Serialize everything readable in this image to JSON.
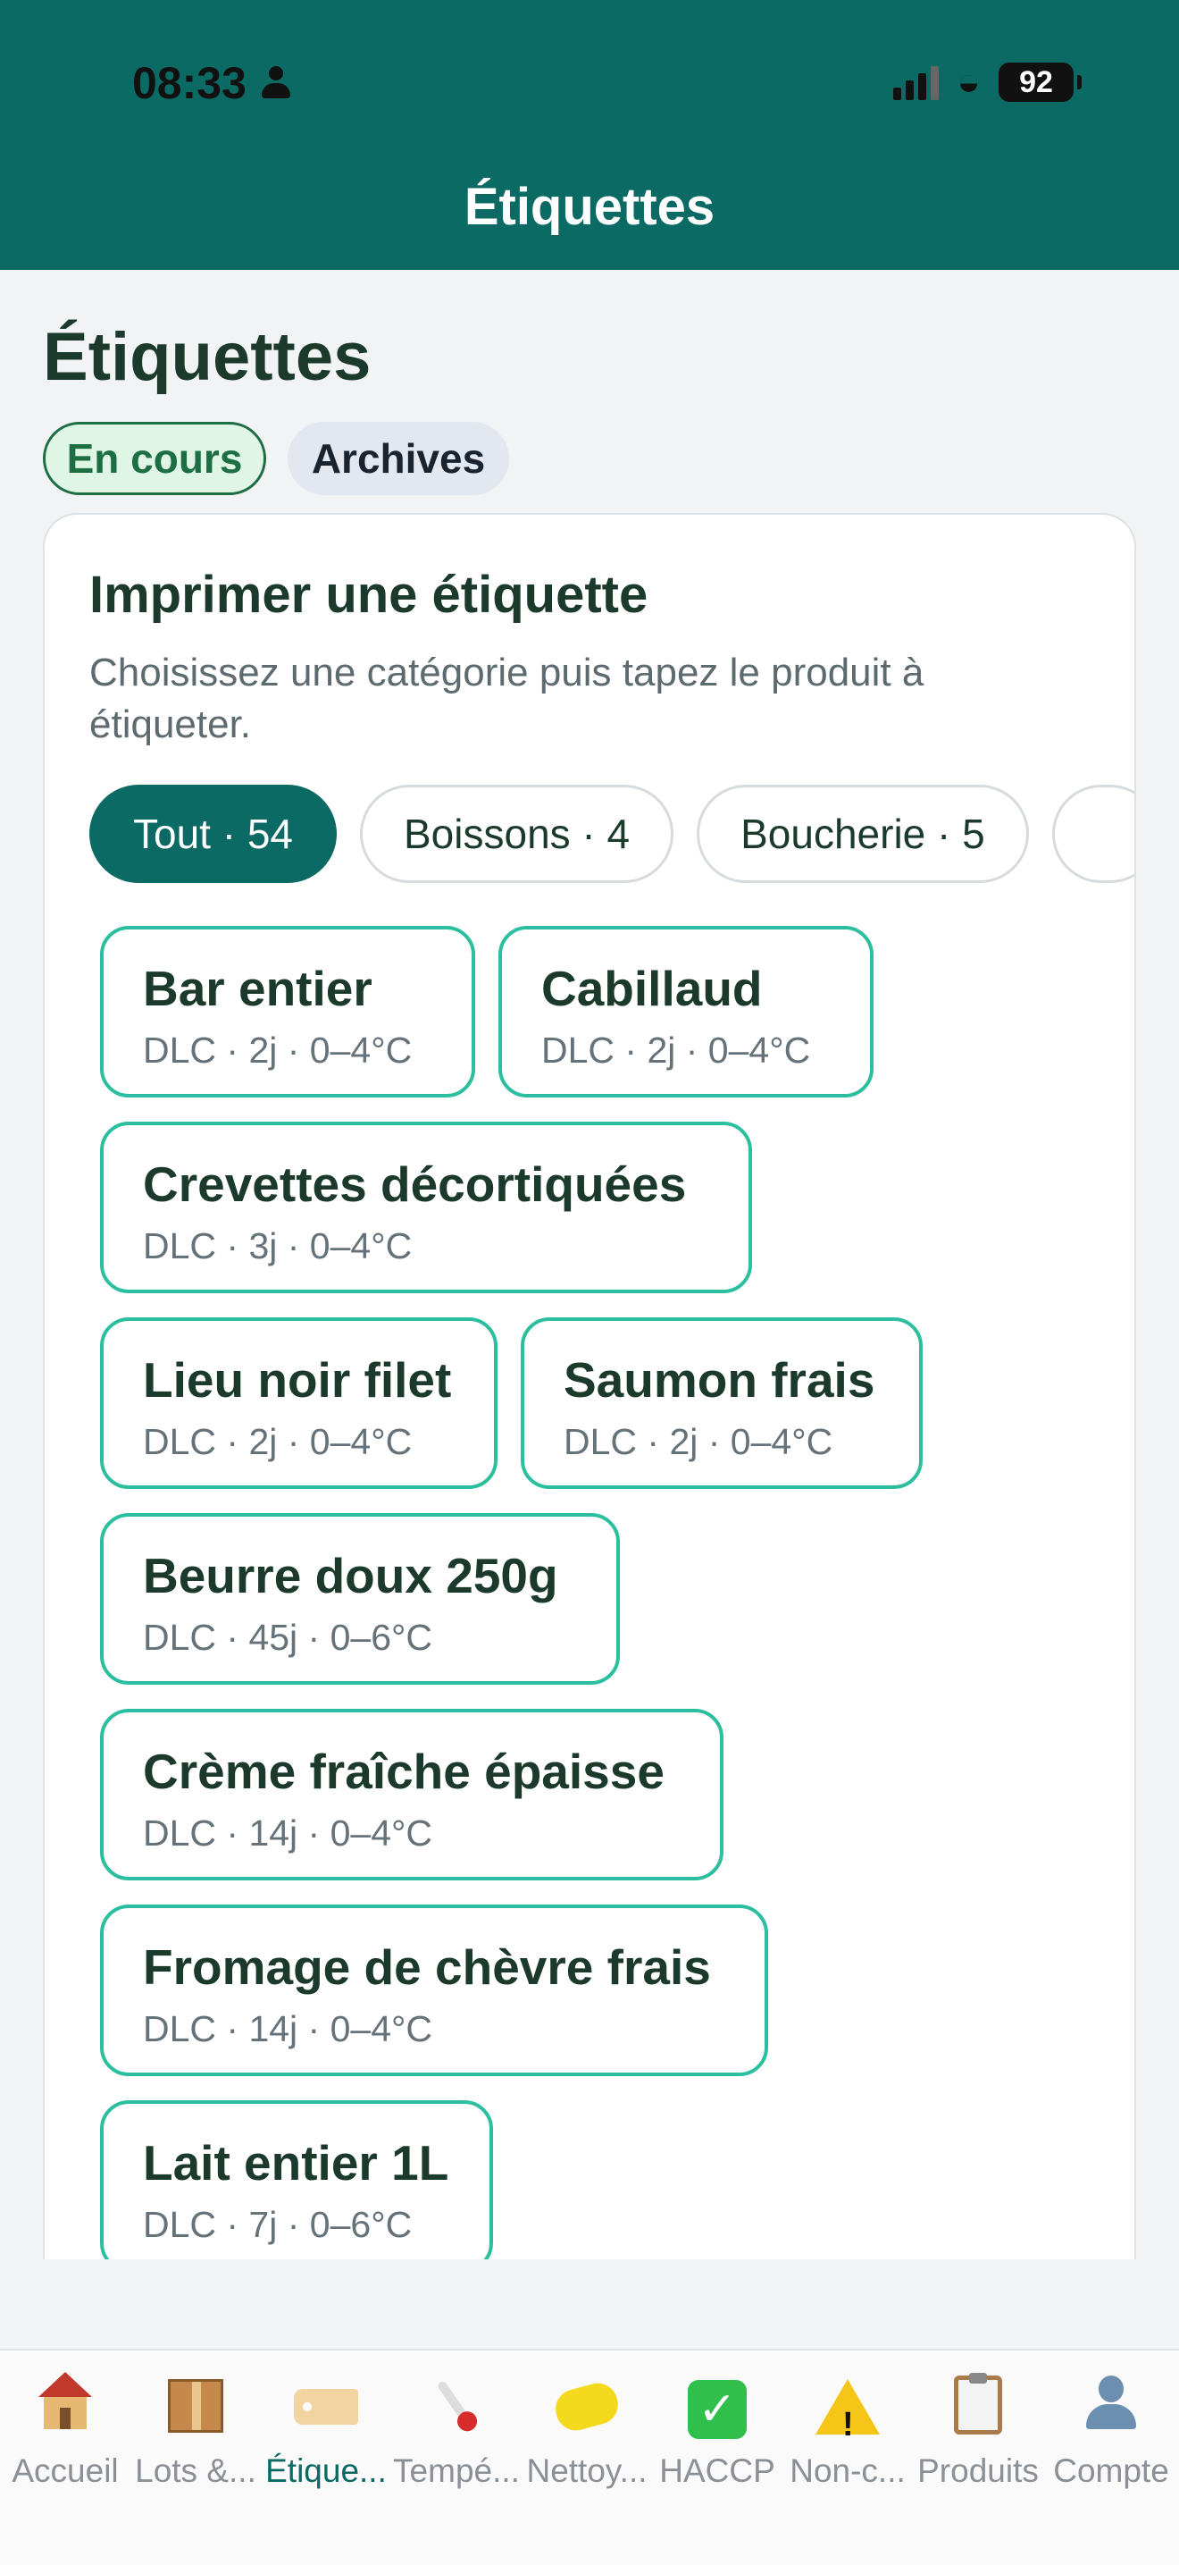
{
  "status_bar": {
    "time": "08:33",
    "battery": "92"
  },
  "nav": {
    "title": "Étiquettes"
  },
  "page": {
    "title": "Étiquettes",
    "segments": [
      "En cours",
      "Archives"
    ]
  },
  "card": {
    "title": "Imprimer une étiquette",
    "description": "Choisissez une catégorie puis tapez le produit à étiqueter.",
    "categories": [
      "Tout · 54",
      "Boissons · 4",
      "Boucherie · 5"
    ],
    "products": [
      {
        "name": "Bar entier",
        "meta": "DLC · 2j · 0–4°C"
      },
      {
        "name": "Cabillaud",
        "meta": "DLC · 2j · 0–4°C"
      },
      {
        "name": "Crevettes décortiquées",
        "meta": "DLC · 3j · 0–4°C"
      },
      {
        "name": "Lieu noir filet",
        "meta": "DLC · 2j · 0–4°C"
      },
      {
        "name": "Saumon frais",
        "meta": "DLC · 2j · 0–4°C"
      },
      {
        "name": "Beurre doux 250g",
        "meta": "DLC · 45j · 0–6°C"
      },
      {
        "name": "Crème fraîche épaisse",
        "meta": "DLC · 14j · 0–4°C"
      },
      {
        "name": "Fromage de chèvre frais",
        "meta": "DLC · 14j · 0–4°C"
      },
      {
        "name": "Lait entier 1L",
        "meta": "DLC · 7j · 0–6°C"
      }
    ]
  },
  "tabbar": {
    "active": "etiquettes",
    "tabs": [
      {
        "label": "Accueil",
        "icon": "house-icon"
      },
      {
        "label": "Lots &...",
        "icon": "package-icon"
      },
      {
        "label": "Étique...",
        "icon": "label-tag-icon"
      },
      {
        "label": "Tempé...",
        "icon": "thermometer-icon"
      },
      {
        "label": "Nettoy...",
        "icon": "sponge-icon"
      },
      {
        "label": "HACCP",
        "icon": "check-mark-icon"
      },
      {
        "label": "Non-c...",
        "icon": "warning-icon"
      },
      {
        "label": "Produits",
        "icon": "clipboard-icon"
      },
      {
        "label": "Compte",
        "icon": "user-icon"
      }
    ]
  }
}
